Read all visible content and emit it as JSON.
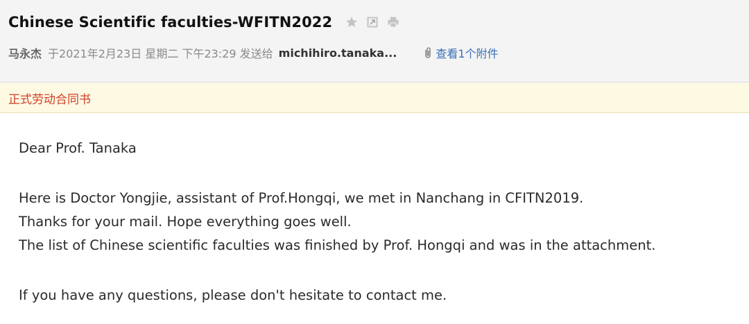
{
  "email": {
    "subject": "Chinese Scientific faculties-WFITN2022",
    "icons": [
      "star-icon",
      "export-icon",
      "print-icon"
    ],
    "sender": "马永杰",
    "date_text": "于2021年2月23日 星期二 下午23:29 发送给",
    "recipient": "michihiro.tanaka...",
    "attachment_link": "查看1个附件"
  },
  "notice": {
    "text": "正式劳动合同书"
  },
  "message": {
    "greeting": "Dear Prof. Tanaka",
    "lines": [
      "Here is Doctor Yongjie, assistant of Prof.Hongqi, we met in Nanchang in CFITN2019.",
      "Thanks for your mail. Hope everything goes well.",
      "The list of Chinese scientific faculties was finished by Prof. Hongqi and was in the attachment."
    ],
    "closing": "If you have any questions, please don't hesitate to contact me."
  },
  "colors": {
    "header_bg": "#f4f4f4",
    "notice_bg": "#fdf9e2",
    "notice_text": "#d0402a",
    "link": "#3b6fb6"
  }
}
